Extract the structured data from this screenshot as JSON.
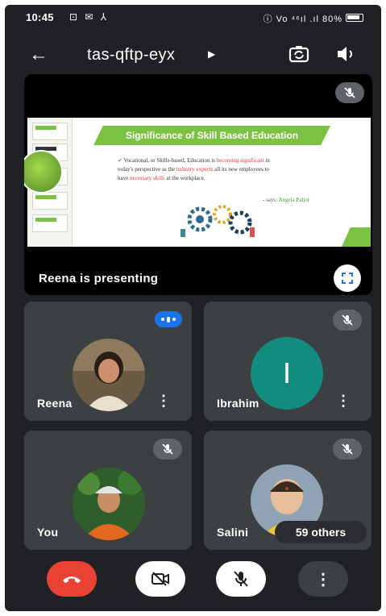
{
  "status_bar": {
    "time": "10:45",
    "left_icons": "⊡ ✉ ⅄",
    "right_icons": "ⓘ Vo ⁴⁶ıl .ıl 80%",
    "battery_icon": "battery-icon"
  },
  "header": {
    "back_icon": "arrow-left-icon",
    "meeting_code": "tas-qftp-eyx",
    "expand_icon": "triangle-right-icon",
    "switch_camera_icon": "camera-switch-icon",
    "speaker_icon": "speaker-icon"
  },
  "presentation": {
    "caption": "Reena is presenting",
    "mic_muted": true,
    "slide": {
      "title": "Significance of Skill Based Education",
      "text_1": "Vocational, or Skills-based, Education is",
      "text_1_hl": "becoming significant",
      "text_1_end": "in",
      "text_2": "today's perspective as the",
      "text_2_hl": "industry expects",
      "text_2_end": "all its new employees to",
      "text_3": "have",
      "text_3_hl": "necessary skills",
      "text_3_end": "at the workplace.",
      "quote_prefix": "- says:",
      "quote_name": "Angela Paljor"
    }
  },
  "participants": [
    {
      "name": "Reena",
      "speaking": true,
      "muted": false,
      "has_menu": true
    },
    {
      "name": "Ibrahim",
      "initial": "I",
      "muted": true,
      "has_menu": true,
      "avatar_color": "#128c7e"
    },
    {
      "name": "You",
      "muted": true,
      "has_menu": false
    },
    {
      "name": "Salini",
      "muted": true,
      "has_menu": false,
      "others_label": "59 others"
    }
  ],
  "controls": {
    "end_call_icon": "phone-hangup-icon",
    "camera_icon": "camera-off-icon",
    "mic_icon": "mic-off-icon",
    "more_icon": "more-vert-icon",
    "more_label": "⋮"
  },
  "colors": {
    "background": "#202124",
    "tile": "#3c4043",
    "end_call": "#ea4335",
    "speaking": "#1a73e8",
    "slide_accent": "#7cc242"
  }
}
